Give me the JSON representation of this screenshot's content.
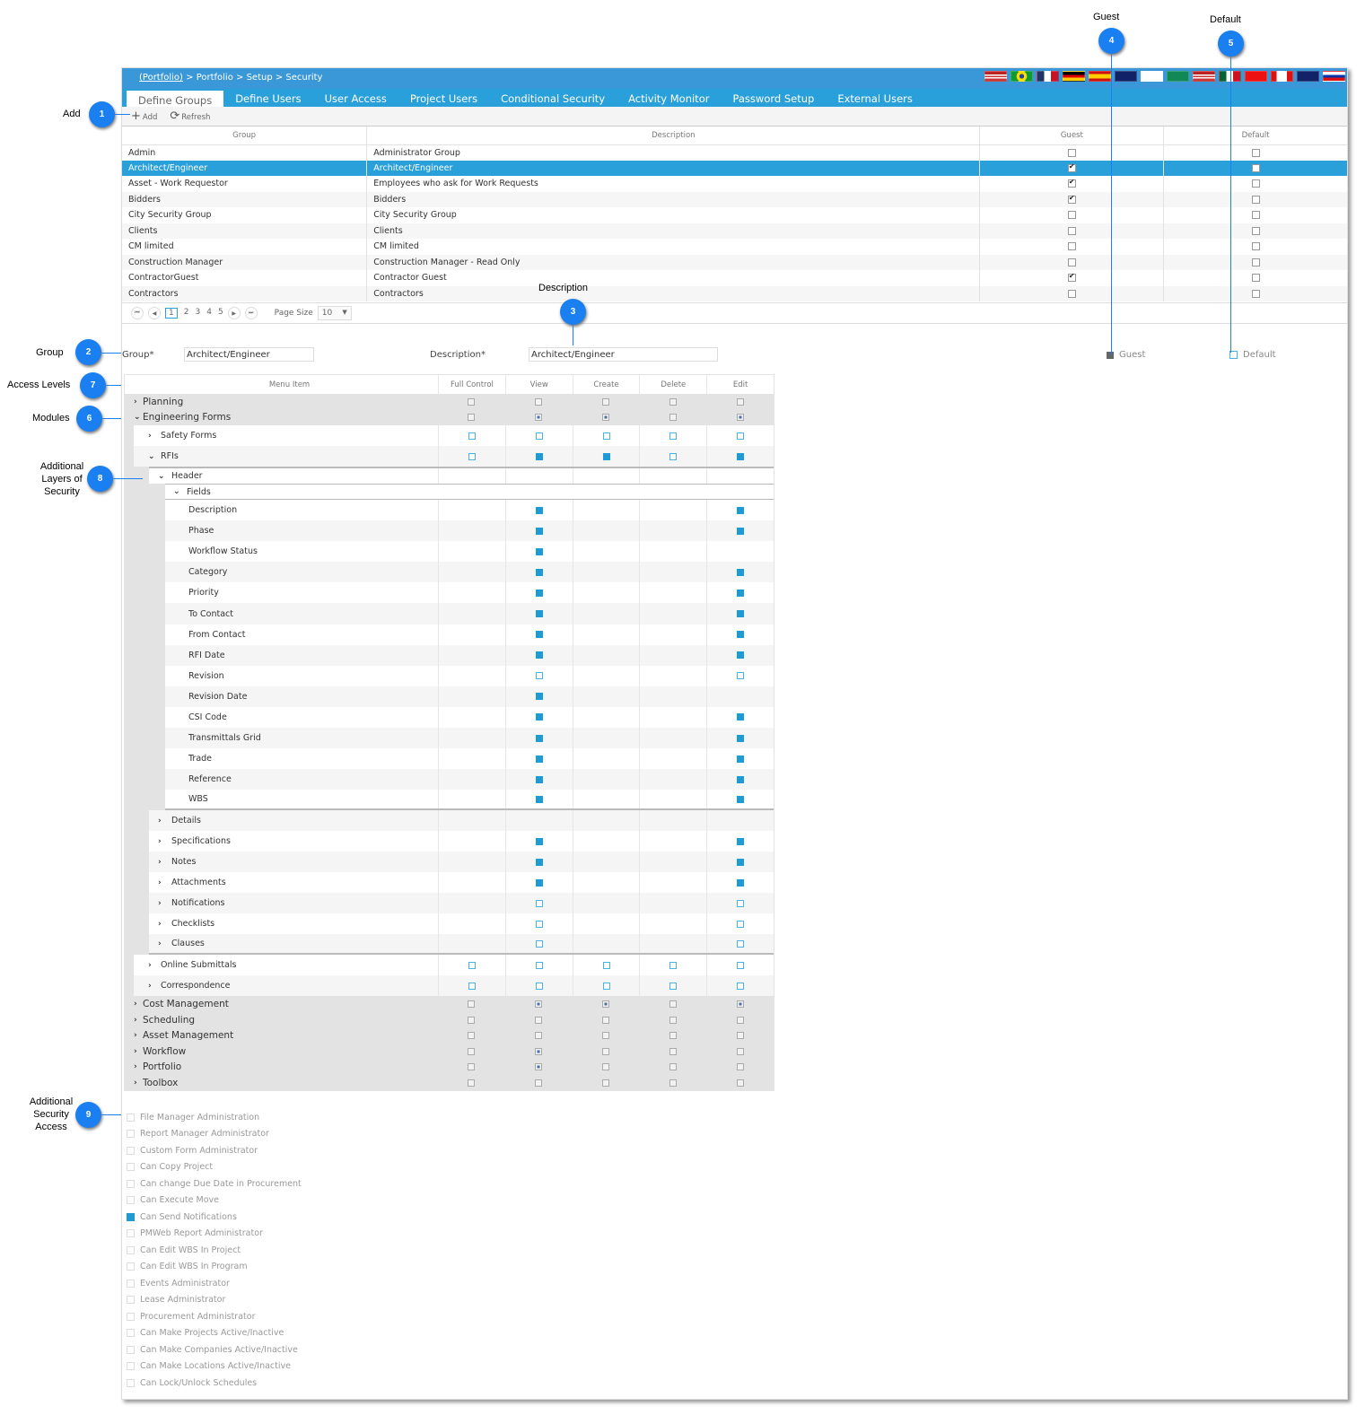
{
  "breadcrumb": {
    "link": "(Portfolio)",
    "rest": " > Portfolio > Setup > Security"
  },
  "flags": [
    "us-flag",
    "brazil-flag",
    "france-flag",
    "germany-flag",
    "spain-flag",
    "australia-flag",
    "intl-flag",
    "saudi-flag",
    "us-flag",
    "mexico-flag",
    "china-flag",
    "canada-flag",
    "newzealand-flag",
    "russia-flag"
  ],
  "tabs": [
    "Define Groups",
    "Define Users",
    "User Access",
    "Project Users",
    "Conditional Security",
    "Activity Monitor",
    "Password Setup",
    "External Users"
  ],
  "toolbar": {
    "add": "Add",
    "refresh": "Refresh"
  },
  "groups_grid": {
    "columns": [
      "Group",
      "Description",
      "Guest",
      "Default"
    ],
    "rows": [
      {
        "group": "Admin",
        "description": "Administrator Group",
        "guest": false,
        "default": false
      },
      {
        "group": "Architect/Engineer",
        "description": "Architect/Engineer",
        "guest": true,
        "default": false,
        "selected": true
      },
      {
        "group": "Asset - Work Requestor",
        "description": "Employees who ask for Work Requests",
        "guest": true,
        "default": false
      },
      {
        "group": "Bidders",
        "description": "Bidders",
        "guest": true,
        "default": false
      },
      {
        "group": "City Security Group",
        "description": "City Security Group",
        "guest": false,
        "default": false
      },
      {
        "group": "Clients",
        "description": "Clients",
        "guest": false,
        "default": false
      },
      {
        "group": "CM limited",
        "description": "CM limited",
        "guest": false,
        "default": false
      },
      {
        "group": "Construction Manager",
        "description": "Construction Manager - Read Only",
        "guest": false,
        "default": false
      },
      {
        "group": "ContractorGuest",
        "description": "Contractor Guest",
        "guest": true,
        "default": false
      },
      {
        "group": "Contractors",
        "description": "Contractors",
        "guest": false,
        "default": false
      }
    ]
  },
  "pager": {
    "pages": [
      "1",
      "2",
      "3",
      "4",
      "5"
    ],
    "current": "1",
    "page_size_label": "Page Size",
    "page_size": "10"
  },
  "form": {
    "group_label": "Group*",
    "group_value": "Architect/Engineer",
    "description_label": "Description*",
    "description_value": "Architect/Engineer",
    "guest_label": "Guest",
    "guest_checked": true,
    "default_label": "Default",
    "default_checked": false
  },
  "permissions": {
    "columns": [
      "Menu Item",
      "Full Control",
      "View",
      "Create",
      "Delete",
      "Edit"
    ],
    "rows": [
      {
        "level": "l0",
        "label": "Planning",
        "exp": "collapsed",
        "p": [
          "g",
          "g",
          "g",
          "g",
          "g"
        ]
      },
      {
        "level": "l0",
        "label": "Engineering Forms",
        "exp": "expanded",
        "p": [
          "g",
          "gc",
          "gc",
          "g",
          "gc"
        ]
      },
      {
        "level": "l1",
        "label": "Safety Forms",
        "exp": "collapsed",
        "p": [
          "o",
          "o",
          "o",
          "o",
          "o"
        ]
      },
      {
        "level": "l1",
        "label": "RFIs",
        "exp": "expanded",
        "p": [
          "o",
          "f",
          "f",
          "o",
          "f"
        ]
      },
      {
        "level": "l2",
        "label": "Header",
        "exp": "expanded",
        "p": [
          "",
          "",
          "",
          "",
          ""
        ]
      },
      {
        "level": "l3",
        "label": "Fields",
        "exp": "expanded",
        "p": null
      },
      {
        "level": "l4",
        "label": "Description",
        "p": [
          "",
          "f",
          "",
          "",
          "f"
        ]
      },
      {
        "level": "l4",
        "label": "Phase",
        "p": [
          "",
          "f",
          "",
          "",
          "f"
        ]
      },
      {
        "level": "l4",
        "label": "Workflow Status",
        "p": [
          "",
          "f",
          "",
          "",
          ""
        ]
      },
      {
        "level": "l4",
        "label": "Category",
        "p": [
          "",
          "f",
          "",
          "",
          "f"
        ]
      },
      {
        "level": "l4",
        "label": "Priority",
        "p": [
          "",
          "f",
          "",
          "",
          "f"
        ]
      },
      {
        "level": "l4",
        "label": "To Contact",
        "p": [
          "",
          "f",
          "",
          "",
          "f"
        ]
      },
      {
        "level": "l4",
        "label": "From Contact",
        "p": [
          "",
          "f",
          "",
          "",
          "f"
        ]
      },
      {
        "level": "l4",
        "label": "RFI Date",
        "p": [
          "",
          "f",
          "",
          "",
          "f"
        ]
      },
      {
        "level": "l4",
        "label": "Revision",
        "p": [
          "",
          "o",
          "",
          "",
          "o"
        ]
      },
      {
        "level": "l4",
        "label": "Revision Date",
        "p": [
          "",
          "f",
          "",
          "",
          ""
        ]
      },
      {
        "level": "l4",
        "label": "CSI Code",
        "p": [
          "",
          "f",
          "",
          "",
          "f"
        ]
      },
      {
        "level": "l4",
        "label": "Transmittals Grid",
        "p": [
          "",
          "f",
          "",
          "",
          "f"
        ]
      },
      {
        "level": "l4",
        "label": "Trade",
        "p": [
          "",
          "f",
          "",
          "",
          "f"
        ]
      },
      {
        "level": "l4",
        "label": "Reference",
        "p": [
          "",
          "f",
          "",
          "",
          "f"
        ]
      },
      {
        "level": "l4",
        "label": "WBS",
        "p": [
          "",
          "f",
          "",
          "",
          "f"
        ]
      },
      {
        "level": "l2b",
        "label": "Details",
        "exp": "collapsed",
        "p": [
          "",
          "",
          "",
          "",
          ""
        ]
      },
      {
        "level": "l2b",
        "label": "Specifications",
        "exp": "collapsed",
        "p": [
          "",
          "f",
          "",
          "",
          "f"
        ]
      },
      {
        "level": "l2b",
        "label": "Notes",
        "exp": "collapsed",
        "p": [
          "",
          "f",
          "",
          "",
          "f"
        ]
      },
      {
        "level": "l2b",
        "label": "Attachments",
        "exp": "collapsed",
        "p": [
          "",
          "f",
          "",
          "",
          "f"
        ]
      },
      {
        "level": "l2b",
        "label": "Notifications",
        "exp": "collapsed",
        "p": [
          "",
          "o",
          "",
          "",
          "o"
        ]
      },
      {
        "level": "l2b",
        "label": "Checklists",
        "exp": "collapsed",
        "p": [
          "",
          "o",
          "",
          "",
          "o"
        ]
      },
      {
        "level": "l2b",
        "label": "Clauses",
        "exp": "collapsed",
        "p": [
          "",
          "o",
          "",
          "",
          "o"
        ]
      },
      {
        "level": "l1",
        "label": "Online Submittals",
        "exp": "collapsed",
        "p": [
          "o",
          "o",
          "o",
          "o",
          "o"
        ]
      },
      {
        "level": "l1",
        "label": "Correspondence",
        "exp": "collapsed",
        "p": [
          "o",
          "o",
          "o",
          "o",
          "o"
        ]
      },
      {
        "level": "l0",
        "label": "Cost Management",
        "exp": "collapsed",
        "p": [
          "g",
          "gc",
          "gc",
          "g",
          "gc"
        ]
      },
      {
        "level": "l0",
        "label": "Scheduling",
        "exp": "collapsed",
        "p": [
          "g",
          "g",
          "g",
          "g",
          "g"
        ]
      },
      {
        "level": "l0",
        "label": "Asset Management",
        "exp": "collapsed",
        "p": [
          "g",
          "g",
          "g",
          "g",
          "g"
        ]
      },
      {
        "level": "l0",
        "label": "Workflow",
        "exp": "collapsed",
        "p": [
          "g",
          "gc",
          "g",
          "g",
          "g"
        ]
      },
      {
        "level": "l0",
        "label": "Portfolio",
        "exp": "collapsed",
        "p": [
          "g",
          "gc",
          "g",
          "g",
          "g"
        ]
      },
      {
        "level": "l0",
        "label": "Toolbox",
        "exp": "collapsed",
        "p": [
          "g",
          "g",
          "g",
          "g",
          "g"
        ]
      }
    ]
  },
  "additional_access": [
    {
      "label": "File Manager Administration",
      "checked": false
    },
    {
      "label": "Report Manager Administrator",
      "checked": false
    },
    {
      "label": "Custom Form Administrator",
      "checked": false
    },
    {
      "label": "Can Copy Project",
      "checked": false
    },
    {
      "label": "Can change Due Date in Procurement",
      "checked": false
    },
    {
      "label": "Can Execute Move",
      "checked": false
    },
    {
      "label": "Can Send Notifications",
      "checked": true
    },
    {
      "label": "PMWeb Report Administrator",
      "checked": false
    },
    {
      "label": "Can Edit WBS In Project",
      "checked": false
    },
    {
      "label": "Can Edit WBS In Program",
      "checked": false
    },
    {
      "label": "Events Administrator",
      "checked": false
    },
    {
      "label": "Lease Administrator",
      "checked": false
    },
    {
      "label": "Procurement Administrator",
      "checked": false
    },
    {
      "label": "Can Make Projects Active/Inactive",
      "checked": false
    },
    {
      "label": "Can Make Companies Active/Inactive",
      "checked": false
    },
    {
      "label": "Can Make Locations Active/Inactive",
      "checked": false
    },
    {
      "label": "Can Lock/Unlock Schedules",
      "checked": false
    }
  ],
  "callouts": [
    {
      "n": "1",
      "label": "Add"
    },
    {
      "n": "2",
      "label": "Group"
    },
    {
      "n": "3",
      "label": "Description"
    },
    {
      "n": "4",
      "label": "Guest"
    },
    {
      "n": "5",
      "label": "Default"
    },
    {
      "n": "6",
      "label": "Modules"
    },
    {
      "n": "7",
      "label": "Access Levels"
    },
    {
      "n": "8",
      "label": "Additional Layers of Security"
    },
    {
      "n": "9",
      "label": "Additional Security Access"
    }
  ],
  "colors": {
    "accent": "#29a0da",
    "breadcrumb_bar": "#3a97d8",
    "callout": "#1a7ff0",
    "checked_fill": "#1e9ad6"
  }
}
